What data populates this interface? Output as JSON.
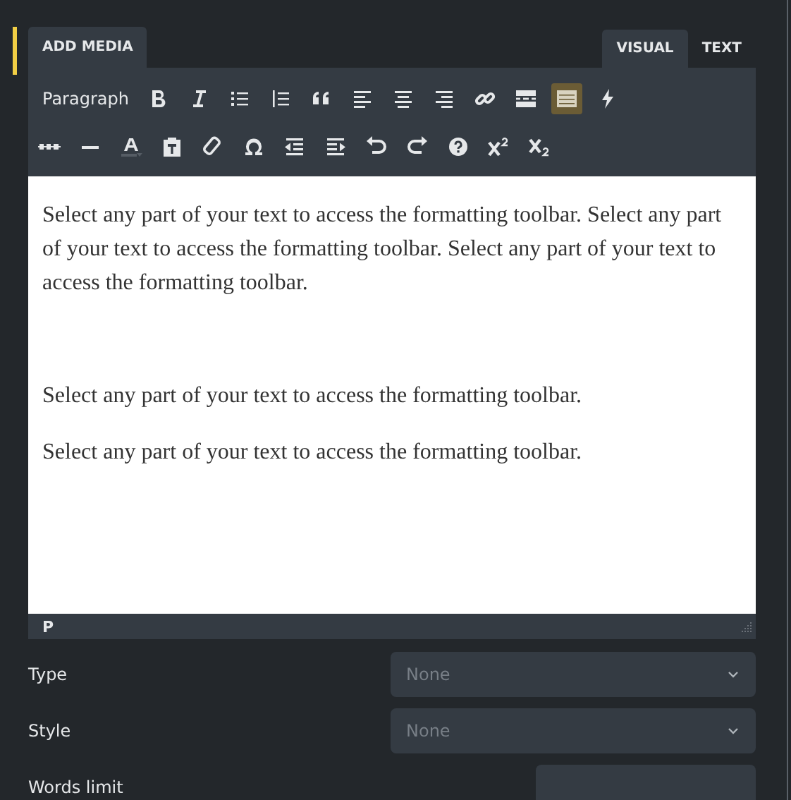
{
  "media_button": {
    "label": "ADD MEDIA"
  },
  "mode_tabs": [
    {
      "label": "VISUAL",
      "selected": true
    },
    {
      "label": "TEXT",
      "selected": false
    }
  ],
  "format_select": {
    "label": "Paragraph"
  },
  "toolbar_rows": [
    [
      {
        "kind": "bold",
        "active": false
      },
      {
        "kind": "italic",
        "active": false
      },
      {
        "kind": "bullets",
        "active": false
      },
      {
        "kind": "numbers",
        "active": false
      },
      {
        "kind": "quote",
        "active": false
      },
      {
        "kind": "alignleft",
        "active": false
      },
      {
        "kind": "aligncenter",
        "active": false
      },
      {
        "kind": "alignright",
        "active": false
      },
      {
        "kind": "link",
        "active": false
      },
      {
        "kind": "more",
        "active": false
      },
      {
        "kind": "toolbar",
        "active": true
      },
      {
        "kind": "bolt",
        "active": false
      }
    ],
    [
      {
        "kind": "strike",
        "active": false
      },
      {
        "kind": "rule",
        "active": false
      },
      {
        "kind": "color",
        "active": false
      },
      {
        "kind": "paste",
        "active": false
      },
      {
        "kind": "eraser",
        "active": false
      },
      {
        "kind": "omega",
        "active": false
      },
      {
        "kind": "outdent",
        "active": false
      },
      {
        "kind": "indent",
        "active": false
      },
      {
        "kind": "undo",
        "active": false
      },
      {
        "kind": "redo",
        "active": false
      },
      {
        "kind": "help",
        "active": false
      },
      {
        "kind": "sup",
        "active": false
      },
      {
        "kind": "sub",
        "active": false
      }
    ]
  ],
  "paragraphs": [
    "Select any part of your text to access the formatting toolbar. Select any part of your text to access the formatting toolbar. Select any part of your text to access the formatting toolbar.",
    "Select any part of your text to access the formatting toolbar.",
    "Select any part of your text to access the formatting toolbar."
  ],
  "status_path": "P",
  "fields": [
    {
      "kind": "select",
      "label": "Type",
      "placeholder": "None"
    },
    {
      "kind": "select",
      "label": "Style",
      "placeholder": "None"
    },
    {
      "kind": "input",
      "label": "Words limit"
    }
  ]
}
